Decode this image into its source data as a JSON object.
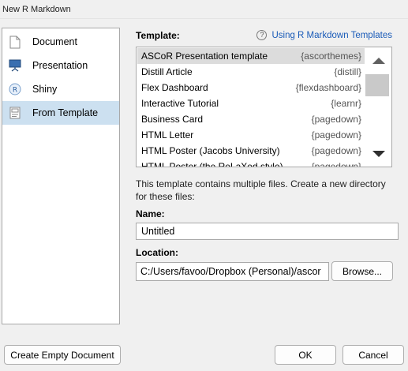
{
  "window": {
    "title": "New R Markdown"
  },
  "sidebar": {
    "items": [
      {
        "label": "Document",
        "icon": "document-icon",
        "selected": false
      },
      {
        "label": "Presentation",
        "icon": "presentation-icon",
        "selected": false
      },
      {
        "label": "Shiny",
        "icon": "shiny-icon",
        "selected": false
      },
      {
        "label": "From Template",
        "icon": "template-icon",
        "selected": true
      }
    ]
  },
  "template": {
    "label": "Template:",
    "help_link": "Using R Markdown Templates",
    "help_icon": "?",
    "items": [
      {
        "name": "ASCoR Presentation template",
        "package": "{ascorthemes}",
        "selected": true
      },
      {
        "name": "Distill Article",
        "package": "{distill}",
        "selected": false
      },
      {
        "name": "Flex Dashboard",
        "package": "{flexdashboard}",
        "selected": false
      },
      {
        "name": "Interactive Tutorial",
        "package": "{learnr}",
        "selected": false
      },
      {
        "name": "Business Card",
        "package": "{pagedown}",
        "selected": false
      },
      {
        "name": "HTML Letter",
        "package": "{pagedown}",
        "selected": false
      },
      {
        "name": "HTML Poster (Jacobs University)",
        "package": "{pagedown}",
        "selected": false
      },
      {
        "name": "HTML Poster (the ReLaXed style)",
        "package": "{pagedown}",
        "selected": false
      }
    ]
  },
  "info_text": "This template contains multiple files. Create a new directory for these files:",
  "name_field": {
    "label": "Name:",
    "value": "Untitled"
  },
  "location_field": {
    "label": "Location:",
    "value": "C:/Users/favoo/Dropbox (Personal)/ascor",
    "browse_label": "Browse..."
  },
  "buttons": {
    "create_empty": "Create Empty Document",
    "ok": "OK",
    "cancel": "Cancel"
  },
  "colors": {
    "selected_sidebar": "#cce0f0",
    "selected_row": "#dcdcdc",
    "link": "#1a5bb8"
  }
}
